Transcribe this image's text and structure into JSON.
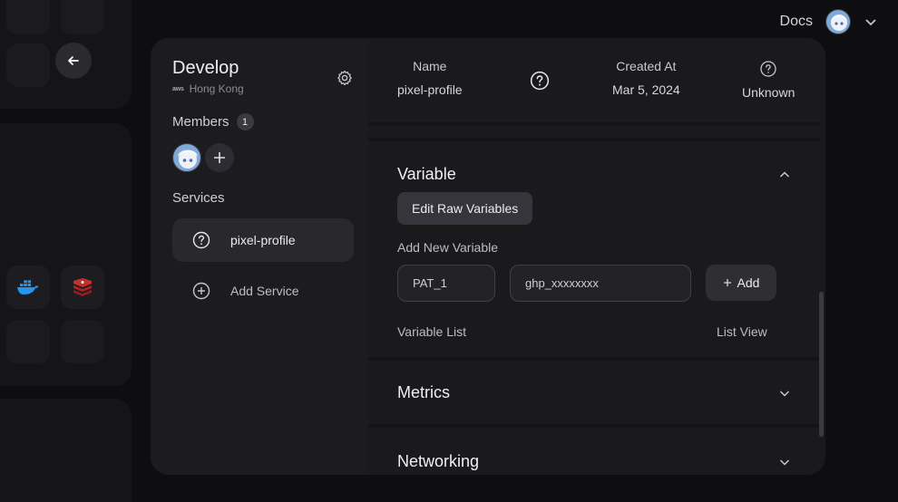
{
  "header": {
    "docs_label": "Docs"
  },
  "project": {
    "title": "Develop",
    "region": "Hong Kong",
    "region_provider_mark": "aws",
    "members_label": "Members",
    "members_count": "1",
    "services_label": "Services",
    "services": [
      {
        "name": "pixel-profile"
      }
    ],
    "add_service_label": "Add Service"
  },
  "service_info": {
    "name_label": "Name",
    "name_value": "pixel-profile",
    "created_label": "Created At",
    "created_value": "Mar 5, 2024",
    "status_value": "Unknown"
  },
  "variable": {
    "title": "Variable",
    "edit_raw_label": "Edit Raw Variables",
    "add_new_label": "Add New Variable",
    "key_value": "PAT_1",
    "value_value": "ghp_xxxxxxxx",
    "add_button_label": "Add",
    "list_label": "Variable List",
    "list_view_label": "List View"
  },
  "metrics": {
    "title": "Metrics"
  },
  "networking": {
    "title": "Networking"
  },
  "colors": {
    "background": "#0e0e10",
    "panel": "#19191c",
    "sidebar": "#1c1c1f",
    "selected_item": "#28282d",
    "docker_blue": "#2496ed",
    "redis_red": "#c4302b"
  }
}
